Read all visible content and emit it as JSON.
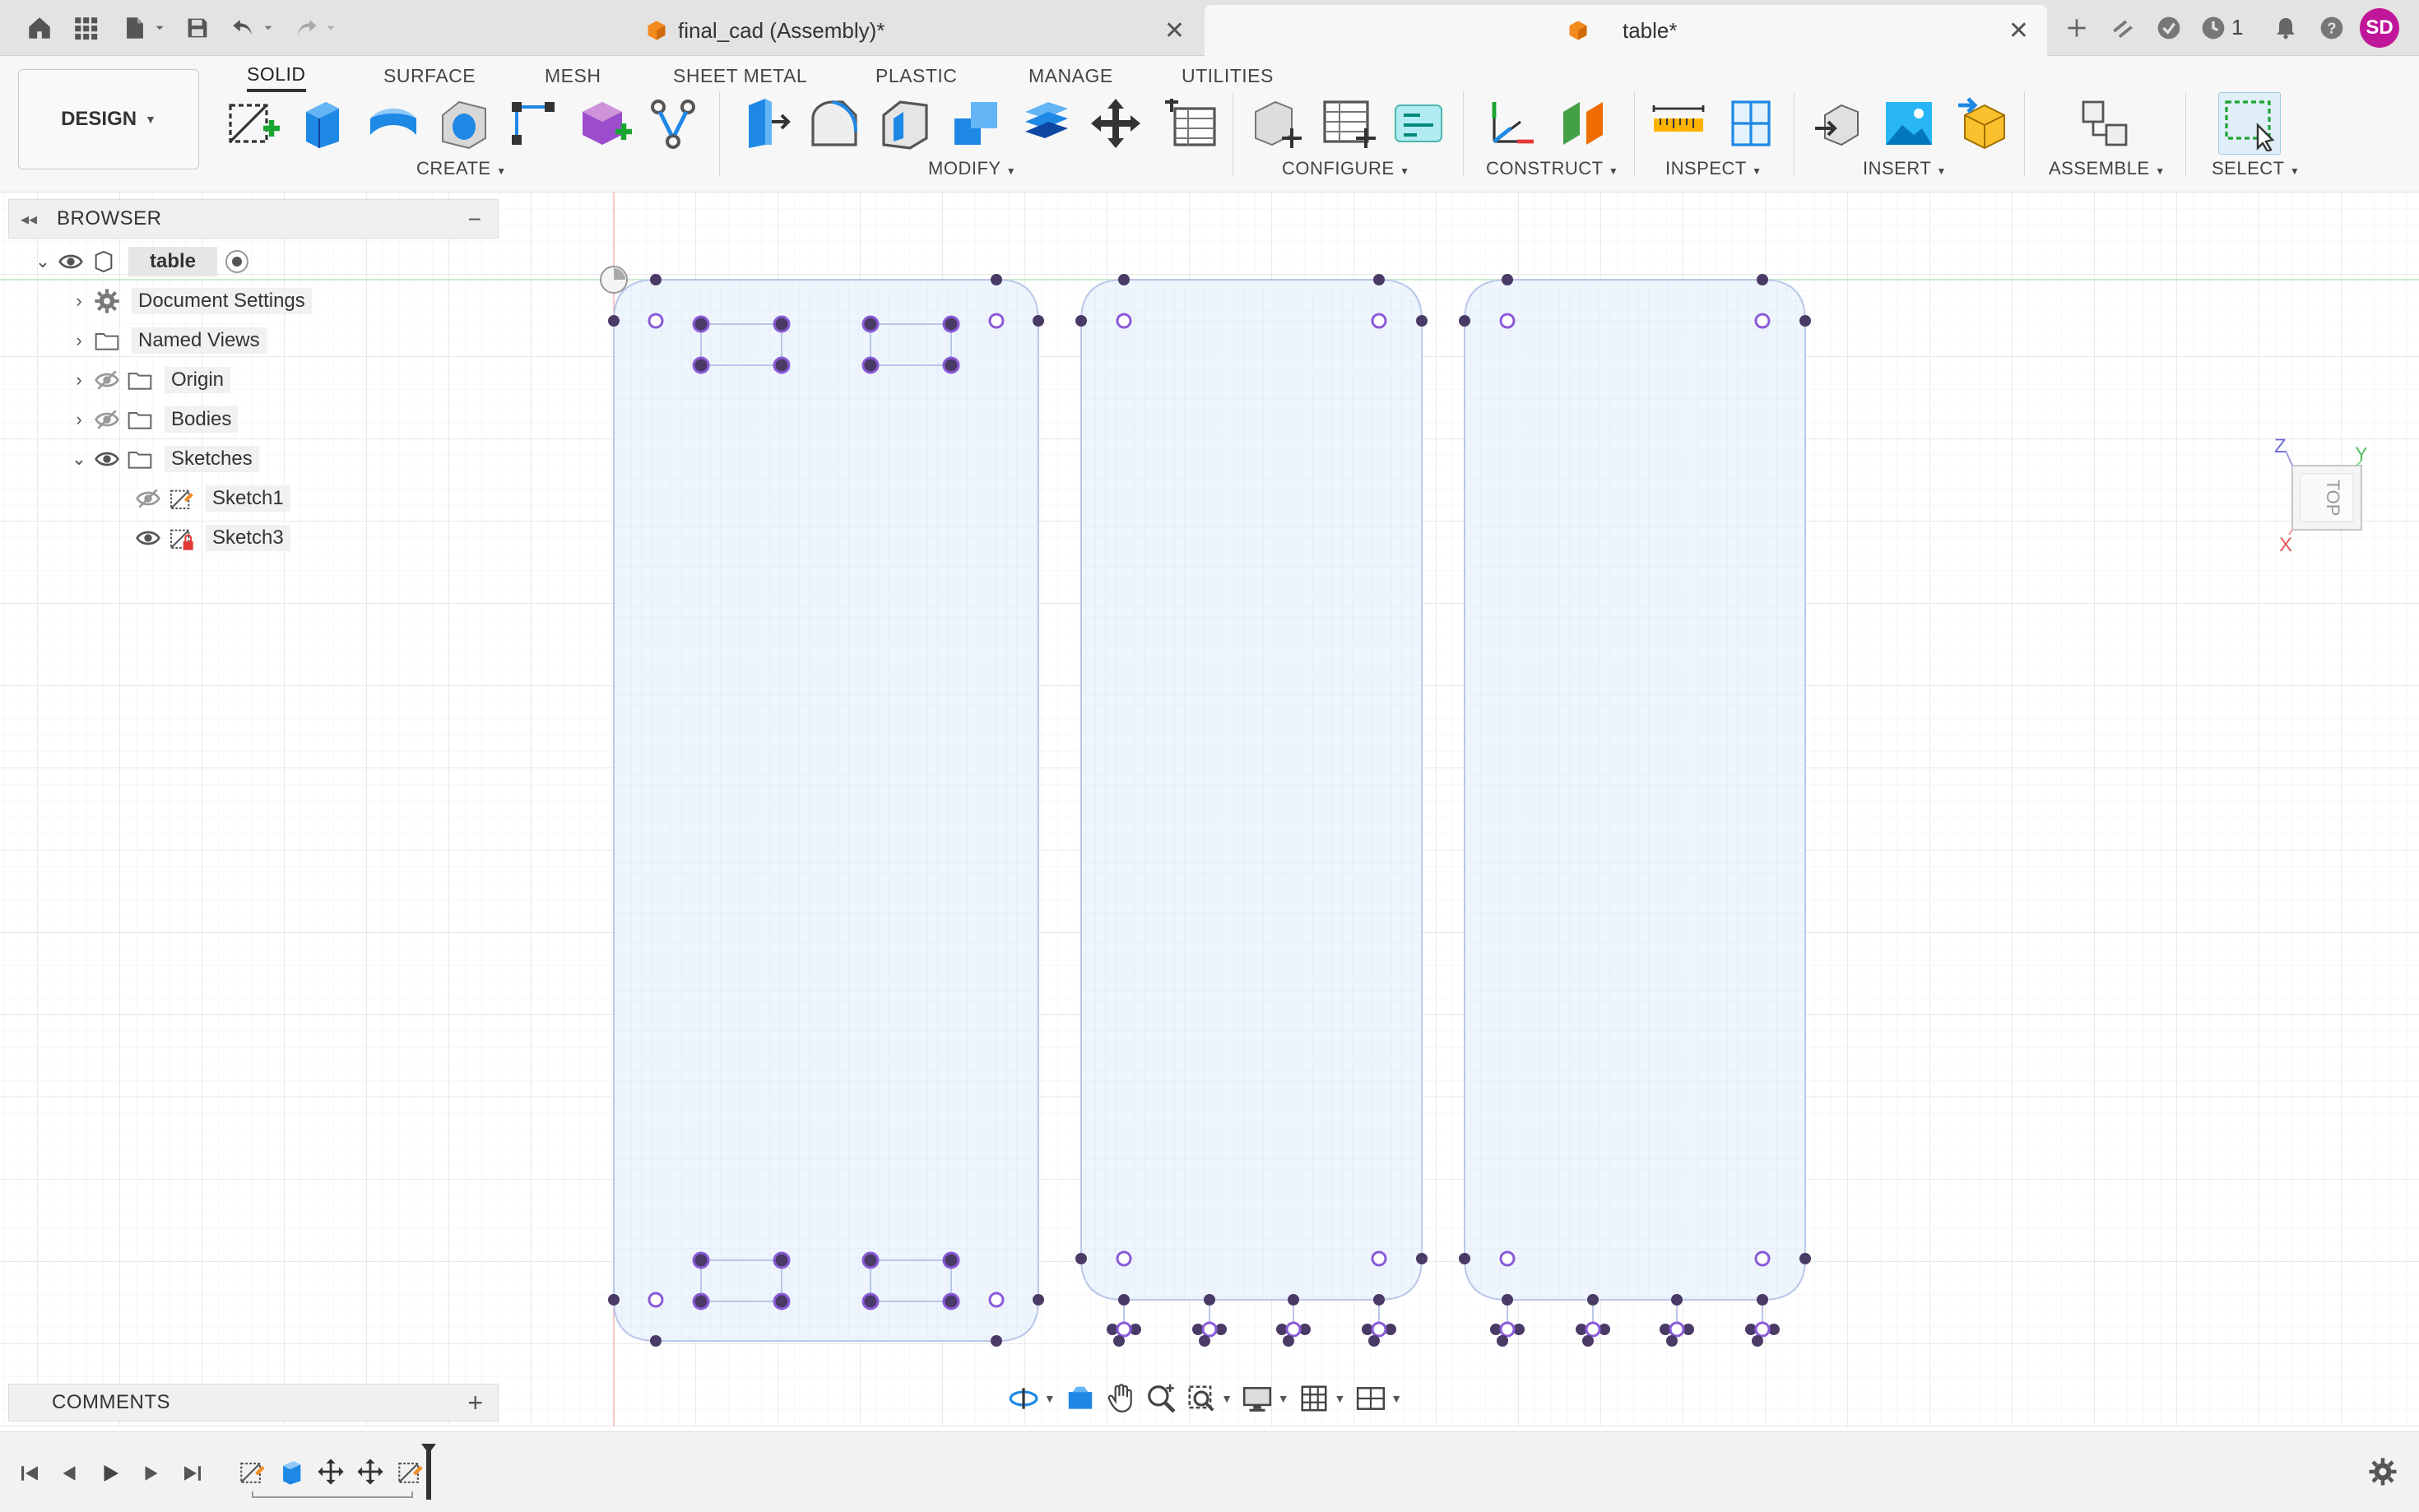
{
  "titlebar": {
    "tabs": [
      {
        "label": "final_cad (Assembly)*",
        "active": false
      },
      {
        "label": "table*",
        "active": true
      }
    ],
    "job_count": "1",
    "user_initials": "SD",
    "icons": [
      "home-icon",
      "apps-grid-icon",
      "file-icon",
      "save-icon",
      "undo-icon",
      "redo-icon",
      "new-tab-icon",
      "extensions-icon",
      "online-status-icon",
      "job-status-icon",
      "notifications-icon",
      "help-icon"
    ]
  },
  "toolbar": {
    "workspace": "DESIGN",
    "workspace_tabs": [
      "SOLID",
      "SURFACE",
      "MESH",
      "SHEET METAL",
      "PLASTIC",
      "MANAGE",
      "UTILITIES"
    ],
    "active_tab": "SOLID",
    "groups": {
      "create": "CREATE",
      "modify": "MODIFY",
      "configure": "CONFIGURE",
      "construct": "CONSTRUCT",
      "inspect": "INSPECT",
      "insert": "INSERT",
      "assemble": "ASSEMBLE",
      "select": "SELECT"
    }
  },
  "browser": {
    "title": "BROWSER",
    "root": "table",
    "items": [
      {
        "label": "Document Settings"
      },
      {
        "label": "Named Views"
      },
      {
        "label": "Origin"
      },
      {
        "label": "Bodies"
      },
      {
        "label": "Sketches"
      },
      {
        "label": "Sketch1"
      },
      {
        "label": "Sketch3"
      }
    ]
  },
  "comments": {
    "title": "COMMENTS"
  },
  "viewcube": {
    "face": "TOP",
    "axis_x": "X",
    "axis_y": "Y",
    "axis_z": "Z"
  },
  "colors": {
    "accent": "#0696d7",
    "sketch_fill": "#eef5fd",
    "sketch_line": "#b9c6e8",
    "point": "#4a3a66",
    "constraint": "#8a5ad8",
    "avatar": "#c0169a"
  }
}
